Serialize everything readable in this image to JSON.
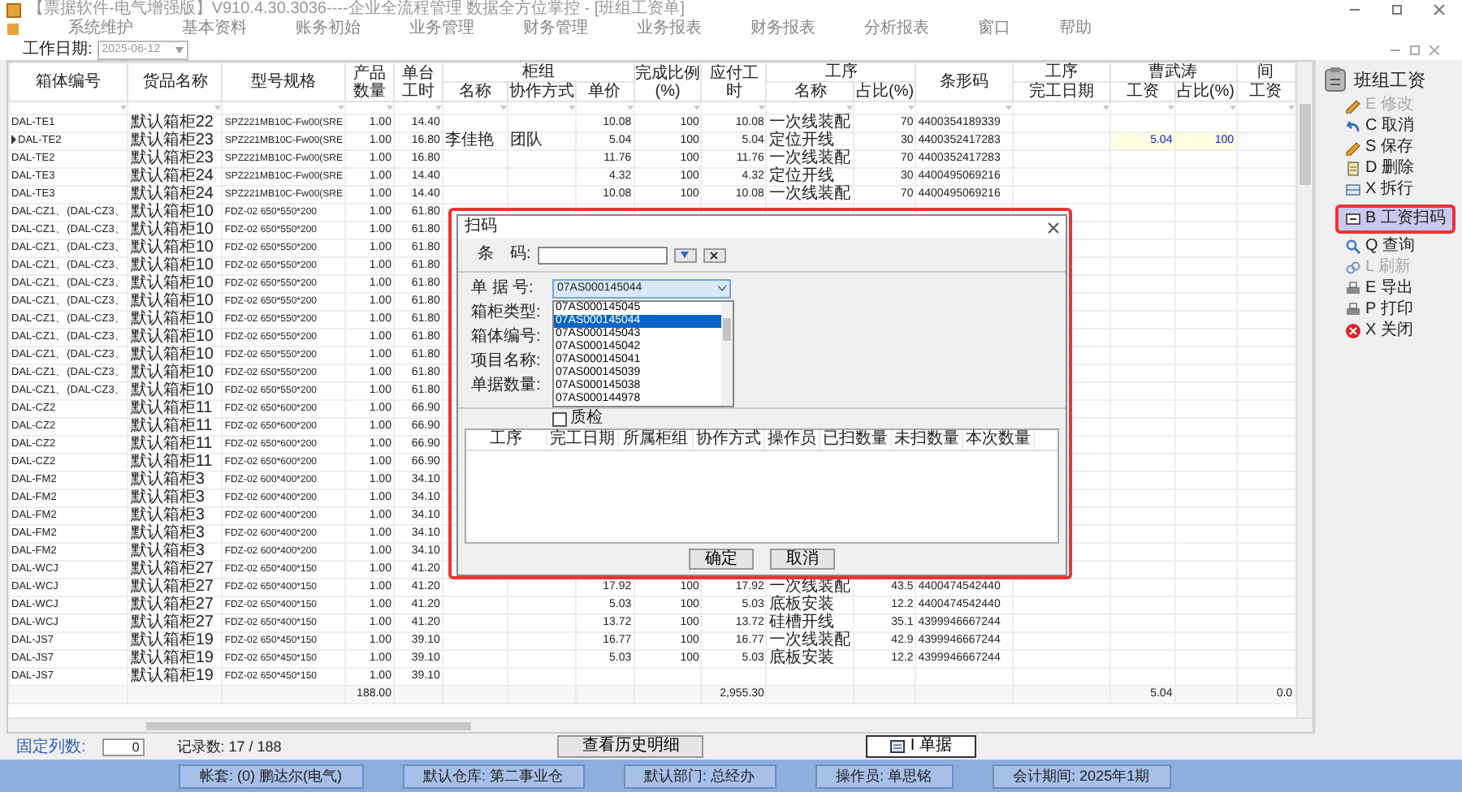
{
  "window": {
    "title": "【票据软件-电气增强版】V910.4.30.3036----企业全流程管理 数据全方位掌控 - [班组工资单]"
  },
  "menu": [
    "系统维护",
    "基本资料",
    "账务初始",
    "业务管理",
    "财务管理",
    "业务报表",
    "财务报表",
    "分析报表",
    "窗口",
    "帮助"
  ],
  "toolbar": {
    "date_label": "工作日期:",
    "date_value": "2025-06-12"
  },
  "table": {
    "columns": [
      {
        "label": "箱体编号"
      },
      {
        "label": "货品名称"
      },
      {
        "label": "型号规格"
      },
      {
        "label": "产品数量"
      },
      {
        "label": "单台工时"
      },
      {
        "label": "柜组",
        "children": [
          {
            "label": "名称"
          },
          {
            "label": "协作方式"
          },
          {
            "label": "单价"
          }
        ]
      },
      {
        "label": "完成比例(%)"
      },
      {
        "label": "应付工时"
      },
      {
        "label": "工序",
        "children": [
          {
            "label": "名称"
          },
          {
            "label": "占比(%)"
          }
        ]
      },
      {
        "label": "条形码"
      },
      {
        "label": "工序",
        "children": [
          {
            "label": "完工日期"
          }
        ]
      },
      {
        "label": "曹武涛",
        "children": [
          {
            "label": "工资"
          },
          {
            "label": "占比(%)"
          }
        ]
      },
      {
        "label": "间",
        "children": [
          {
            "label": "工资"
          }
        ]
      }
    ],
    "rows": [
      {
        "selected": false,
        "box_no": "DAL-TE1",
        "product": "默认箱柜22",
        "model": "SPZ221MB10C-Fw00(SRE",
        "qty": "1.00",
        "unit_hours": "14.40",
        "price": "10.08",
        "completion": "100",
        "payable": "10.08",
        "process_name": "一次线装配",
        "process_share": "70",
        "barcode": "4400354189339"
      },
      {
        "selected": true,
        "box_no": "DAL-TE2",
        "product": "默认箱柜23",
        "model": "SPZ221MB10C-Fw00(SRE",
        "qty": "1.00",
        "unit_hours": "16.80",
        "team_name": "李佳艳",
        "cooperation": "团队",
        "price": "5.04",
        "completion": "100",
        "payable": "5.04",
        "process_name": "定位开线",
        "process_share": "30",
        "barcode": "4400352417283",
        "wage": "5.04",
        "wage_share": "100"
      },
      {
        "selected": false,
        "box_no": "DAL-TE2",
        "product": "默认箱柜23",
        "model": "SPZ221MB10C-Fw00(SRE",
        "qty": "1.00",
        "unit_hours": "16.80",
        "price": "11.76",
        "completion": "100",
        "payable": "11.76",
        "process_name": "一次线装配",
        "process_share": "70",
        "barcode": "4400352417283"
      },
      {
        "selected": false,
        "box_no": "DAL-TE3",
        "product": "默认箱柜24",
        "model": "SPZ221MB10C-Fw00(SRE",
        "qty": "1.00",
        "unit_hours": "14.40",
        "price": "4.32",
        "completion": "100",
        "payable": "4.32",
        "process_name": "定位开线",
        "process_share": "30",
        "barcode": "4400495069216"
      },
      {
        "selected": false,
        "box_no": "DAL-TE3",
        "product": "默认箱柜24",
        "model": "SPZ221MB10C-Fw00(SRE",
        "qty": "1.00",
        "unit_hours": "14.40",
        "price": "10.08",
        "completion": "100",
        "payable": "10.08",
        "process_name": "一次线装配",
        "process_share": "70",
        "barcode": "4400495069216"
      },
      {
        "selected": false,
        "box_no": "DAL-CZ1、(DAL-CZ3、",
        "product": "默认箱柜10",
        "model": "FDZ-02 650*550*200",
        "qty": "1.00",
        "unit_hours": "61.80"
      },
      {
        "selected": false,
        "box_no": "DAL-CZ1、(DAL-CZ3、",
        "product": "默认箱柜10",
        "model": "FDZ-02 650*550*200",
        "qty": "1.00",
        "unit_hours": "61.80"
      },
      {
        "selected": false,
        "box_no": "DAL-CZ1、(DAL-CZ3、",
        "product": "默认箱柜10",
        "model": "FDZ-02 650*550*200",
        "qty": "1.00",
        "unit_hours": "61.80"
      },
      {
        "selected": false,
        "box_no": "DAL-CZ1、(DAL-CZ3、",
        "product": "默认箱柜10",
        "model": "FDZ-02 650*550*200",
        "qty": "1.00",
        "unit_hours": "61.80"
      },
      {
        "selected": false,
        "box_no": "DAL-CZ1、(DAL-CZ3、",
        "product": "默认箱柜10",
        "model": "FDZ-02 650*550*200",
        "qty": "1.00",
        "unit_hours": "61.80"
      },
      {
        "selected": false,
        "box_no": "DAL-CZ1、(DAL-CZ3、",
        "product": "默认箱柜10",
        "model": "FDZ-02 650*550*200",
        "qty": "1.00",
        "unit_hours": "61.80"
      },
      {
        "selected": false,
        "box_no": "DAL-CZ1、(DAL-CZ3、",
        "product": "默认箱柜10",
        "model": "FDZ-02 650*550*200",
        "qty": "1.00",
        "unit_hours": "61.80"
      },
      {
        "selected": false,
        "box_no": "DAL-CZ1、(DAL-CZ3、",
        "product": "默认箱柜10",
        "model": "FDZ-02 650*550*200",
        "qty": "1.00",
        "unit_hours": "61.80"
      },
      {
        "selected": false,
        "box_no": "DAL-CZ1、(DAL-CZ3、",
        "product": "默认箱柜10",
        "model": "FDZ-02 650*550*200",
        "qty": "1.00",
        "unit_hours": "61.80"
      },
      {
        "selected": false,
        "box_no": "DAL-CZ1、(DAL-CZ3、",
        "product": "默认箱柜10",
        "model": "FDZ-02 650*550*200",
        "qty": "1.00",
        "unit_hours": "61.80"
      },
      {
        "selected": false,
        "box_no": "DAL-CZ1、(DAL-CZ3、",
        "product": "默认箱柜10",
        "model": "FDZ-02 650*550*200",
        "qty": "1.00",
        "unit_hours": "61.80"
      },
      {
        "selected": false,
        "box_no": "DAL-CZ2",
        "product": "默认箱柜11",
        "model": "FDZ-02 650*600*200",
        "qty": "1.00",
        "unit_hours": "66.90"
      },
      {
        "selected": false,
        "box_no": "DAL-CZ2",
        "product": "默认箱柜11",
        "model": "FDZ-02 650*600*200",
        "qty": "1.00",
        "unit_hours": "66.90"
      },
      {
        "selected": false,
        "box_no": "DAL-CZ2",
        "product": "默认箱柜11",
        "model": "FDZ-02 650*600*200",
        "qty": "1.00",
        "unit_hours": "66.90"
      },
      {
        "selected": false,
        "box_no": "DAL-CZ2",
        "product": "默认箱柜11",
        "model": "FDZ-02 650*600*200",
        "qty": "1.00",
        "unit_hours": "66.90"
      },
      {
        "selected": false,
        "box_no": "DAL-FM2",
        "product": "默认箱柜3",
        "model": "FDZ-02 600*400*200",
        "qty": "1.00",
        "unit_hours": "34.10"
      },
      {
        "selected": false,
        "box_no": "DAL-FM2",
        "product": "默认箱柜3",
        "model": "FDZ-02 600*400*200",
        "qty": "1.00",
        "unit_hours": "34.10"
      },
      {
        "selected": false,
        "box_no": "DAL-FM2",
        "product": "默认箱柜3",
        "model": "FDZ-02 600*400*200",
        "qty": "1.00",
        "unit_hours": "34.10"
      },
      {
        "selected": false,
        "box_no": "DAL-FM2",
        "product": "默认箱柜3",
        "model": "FDZ-02 600*400*200",
        "qty": "1.00",
        "unit_hours": "34.10"
      },
      {
        "selected": false,
        "box_no": "DAL-FM2",
        "product": "默认箱柜3",
        "model": "FDZ-02 600*400*200",
        "qty": "1.00",
        "unit_hours": "34.10"
      },
      {
        "selected": false,
        "box_no": "DAL-WCJ",
        "product": "默认箱柜27",
        "model": "FDZ-02 650*400*150",
        "qty": "1.00",
        "unit_hours": "41.20"
      },
      {
        "selected": false,
        "box_no": "DAL-WCJ",
        "product": "默认箱柜27",
        "model": "FDZ-02 650*400*150",
        "qty": "1.00",
        "unit_hours": "41.20",
        "price": "17.92",
        "completion": "100",
        "payable": "17.92",
        "process_name": "一次线装配",
        "process_share": "43.5",
        "barcode": "4400474542440"
      },
      {
        "selected": false,
        "box_no": "DAL-WCJ",
        "product": "默认箱柜27",
        "model": "FDZ-02 650*400*150",
        "qty": "1.00",
        "unit_hours": "41.20",
        "price": "5.03",
        "completion": "100",
        "payable": "5.03",
        "process_name": "底板安装",
        "process_share": "12.2",
        "barcode": "4400474542440"
      },
      {
        "selected": false,
        "box_no": "DAL-WCJ",
        "product": "默认箱柜27",
        "model": "FDZ-02 650*400*150",
        "qty": "1.00",
        "unit_hours": "41.20",
        "price": "13.72",
        "completion": "100",
        "payable": "13.72",
        "process_name": "硅槽开线",
        "process_share": "35.1",
        "barcode": "4399946667244"
      },
      {
        "selected": false,
        "box_no": "DAL-JS7",
        "product": "默认箱柜19",
        "model": "FDZ-02 650*450*150",
        "qty": "1.00",
        "unit_hours": "39.10",
        "price": "16.77",
        "completion": "100",
        "payable": "16.77",
        "process_name": "一次线装配",
        "process_share": "42.9",
        "barcode": "4399946667244"
      },
      {
        "selected": false,
        "box_no": "DAL-JS7",
        "product": "默认箱柜19",
        "model": "FDZ-02 650*450*150",
        "qty": "1.00",
        "unit_hours": "39.10",
        "price": "5.03",
        "completion": "100",
        "payable": "5.03",
        "process_name": "底板安装",
        "process_share": "12.2",
        "barcode": "4399946667244"
      },
      {
        "selected": false,
        "box_no": "DAL-JS7",
        "product": "默认箱柜19",
        "model": "FDZ-02 650*450*150",
        "qty": "1.00",
        "unit_hours": "39.10"
      }
    ],
    "totals": {
      "qty": "188.00",
      "payable": "2,955.30",
      "wage": "5.04",
      "wage_2": "0.0"
    }
  },
  "side_panel": {
    "title": "班组工资",
    "buttons": [
      {
        "key": "E",
        "label": "修改",
        "disabled": true,
        "selected": false
      },
      {
        "key": "C",
        "label": "取消",
        "disabled": false,
        "selected": false
      },
      {
        "key": "S",
        "label": "保存",
        "disabled": false,
        "selected": false
      },
      {
        "key": "D",
        "label": "删除",
        "disabled": false,
        "selected": false
      },
      {
        "key": "X",
        "label": "拆行",
        "disabled": false,
        "selected": false
      },
      {
        "key": "B",
        "label": "工资扫码",
        "disabled": false,
        "selected": true
      },
      {
        "key": "Q",
        "label": "查询",
        "disabled": false,
        "selected": false
      },
      {
        "key": "L",
        "label": "刷新",
        "disabled": true,
        "selected": false
      },
      {
        "key": "E",
        "label": "导出",
        "disabled": false,
        "selected": false
      },
      {
        "key": "P",
        "label": "打印",
        "disabled": false,
        "selected": false
      },
      {
        "key": "X",
        "label": "关闭",
        "disabled": false,
        "selected": false
      }
    ]
  },
  "dialog": {
    "title": "扫码",
    "barcode_label": "条　码:",
    "doc_label": "单 据 号:",
    "doc_value": "07AS000145044",
    "doc_options": [
      {
        "label": "07AS000145045",
        "selected": false
      },
      {
        "label": "07AS000145044",
        "selected": true
      },
      {
        "label": "07AS000145043",
        "selected": false
      },
      {
        "label": "07AS000145042",
        "selected": false
      },
      {
        "label": "07AS000145041",
        "selected": false
      },
      {
        "label": "07AS000145039",
        "selected": false
      },
      {
        "label": "07AS000145038",
        "selected": false
      },
      {
        "label": "07AS000144978",
        "selected": false
      }
    ],
    "field_labels": [
      "箱柜类型:",
      "箱体编号:",
      "项目名称:",
      "单据数量:"
    ],
    "qc": {
      "label": "质检",
      "checked": false
    },
    "columns": [
      "工序",
      "完工日期",
      "所属柜组",
      "协作方式",
      "操作员",
      "已扫数量",
      "未扫数量",
      "本次数量"
    ],
    "buttons": [
      "确定",
      "取消"
    ]
  },
  "footer": {
    "fixed_label": "固定列数:",
    "fixed_value": "0",
    "records": "记录数: 17 / 188",
    "history_button": "查看历史明细",
    "doc_button": "I 单据"
  },
  "status_bar": [
    "帐套: (0) 鹏达尔(电气)",
    "默认仓库: 第二事业仓",
    "默认部门: 总经办",
    "操作员: 单思铭",
    "会计期间: 2025年1期"
  ]
}
